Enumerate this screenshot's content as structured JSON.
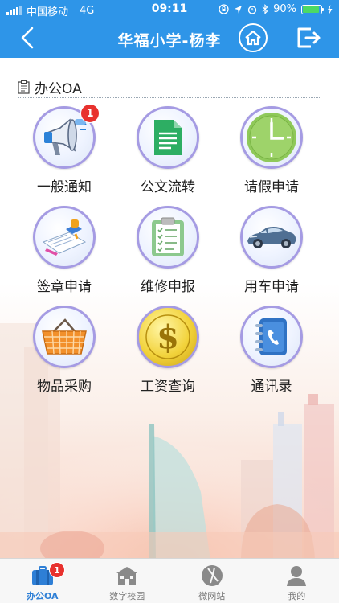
{
  "status_bar": {
    "carrier": "中国移动",
    "network": "4G",
    "time": "09:11",
    "battery_percent": "90%",
    "battery_level": 0.9
  },
  "header": {
    "title": "华福小学-杨李",
    "back_icon": "chevron-left-icon",
    "home_icon": "home-icon",
    "logout_icon": "logout-icon"
  },
  "section": {
    "title": "办公OA",
    "icon": "clipboard-icon"
  },
  "modules": [
    {
      "label": "一般通知",
      "icon": "megaphone-icon",
      "badge": "1"
    },
    {
      "label": "公文流转",
      "icon": "document-icon",
      "badge": ""
    },
    {
      "label": "请假申请",
      "icon": "clock-icon",
      "badge": ""
    },
    {
      "label": "签章申请",
      "icon": "stamp-icon",
      "badge": ""
    },
    {
      "label": "维修申报",
      "icon": "clipboard-check-icon",
      "badge": ""
    },
    {
      "label": "用车申请",
      "icon": "car-icon",
      "badge": ""
    },
    {
      "label": "物品采购",
      "icon": "basket-icon",
      "badge": ""
    },
    {
      "label": "工资查询",
      "icon": "dollar-coin-icon",
      "badge": ""
    },
    {
      "label": "通讯录",
      "icon": "address-book-icon",
      "badge": ""
    }
  ],
  "tabs": [
    {
      "label": "办公OA",
      "icon": "briefcase-icon",
      "badge": "1",
      "active": true
    },
    {
      "label": "数字校园",
      "icon": "school-icon",
      "badge": "",
      "active": false
    },
    {
      "label": "微网站",
      "icon": "compass-icon",
      "badge": "",
      "active": false
    },
    {
      "label": "我的",
      "icon": "user-icon",
      "badge": "",
      "active": false
    }
  ],
  "colors": {
    "header_bg": "#2e95e8",
    "badge": "#e8312e",
    "active_tab": "#2e7fd6",
    "circle_border": "#a59be3"
  }
}
